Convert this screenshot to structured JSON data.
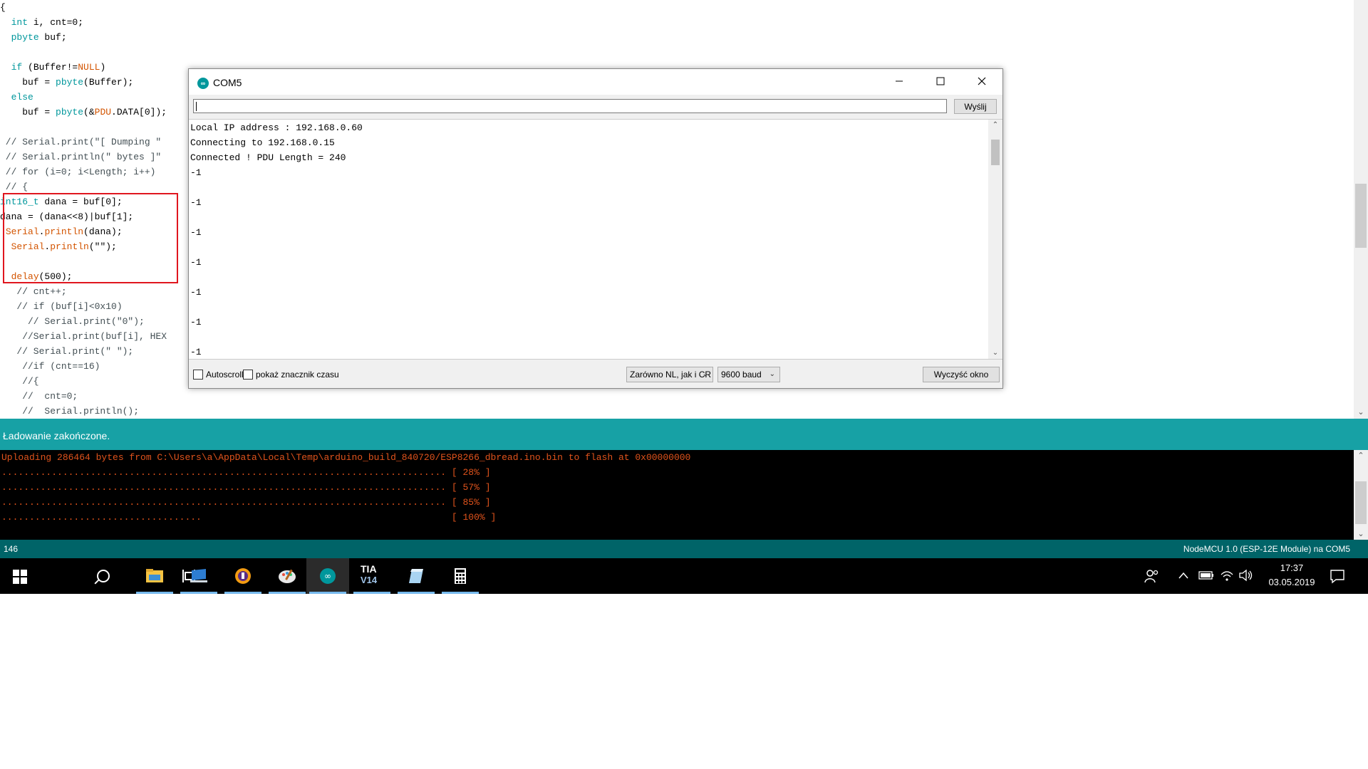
{
  "editor": {
    "lines": [
      [
        {
          "t": "{",
          "c": ""
        }
      ],
      [
        {
          "t": "  ",
          "c": ""
        },
        {
          "t": "int",
          "c": "kw"
        },
        {
          "t": " i, cnt=0;",
          "c": ""
        }
      ],
      [
        {
          "t": "  ",
          "c": ""
        },
        {
          "t": "pbyte",
          "c": "kw"
        },
        {
          "t": " buf;",
          "c": ""
        }
      ],
      [
        {
          "t": "",
          "c": ""
        }
      ],
      [
        {
          "t": "  ",
          "c": ""
        },
        {
          "t": "if",
          "c": "kw"
        },
        {
          "t": " (Buffer!=",
          "c": ""
        },
        {
          "t": "NULL",
          "c": "kw2"
        },
        {
          "t": ")",
          "c": ""
        }
      ],
      [
        {
          "t": "    buf = ",
          "c": ""
        },
        {
          "t": "pbyte",
          "c": "kw"
        },
        {
          "t": "(Buffer);",
          "c": ""
        }
      ],
      [
        {
          "t": "  ",
          "c": ""
        },
        {
          "t": "else",
          "c": "kw"
        }
      ],
      [
        {
          "t": "    buf = ",
          "c": ""
        },
        {
          "t": "pbyte",
          "c": "kw"
        },
        {
          "t": "(&",
          "c": ""
        },
        {
          "t": "PDU",
          "c": "kw2"
        },
        {
          "t": ".DATA[0]);",
          "c": ""
        }
      ],
      [
        {
          "t": "",
          "c": ""
        }
      ],
      [
        {
          "t": " // Serial.print(\"[ Dumping \"",
          "c": "cm"
        }
      ],
      [
        {
          "t": " // Serial.println(\" bytes ]\"",
          "c": "cm"
        }
      ],
      [
        {
          "t": " // for (i=0; i<Length; i++)",
          "c": "cm"
        }
      ],
      [
        {
          "t": " // {",
          "c": "cm"
        }
      ],
      [
        {
          "t": "int16_t",
          "c": "kw"
        },
        {
          "t": " dana = buf[0];",
          "c": ""
        }
      ],
      [
        {
          "t": "dana = (dana<<8)|buf[1];",
          "c": ""
        }
      ],
      [
        {
          "t": " ",
          "c": ""
        },
        {
          "t": "Serial",
          "c": "kw2"
        },
        {
          "t": ".",
          "c": ""
        },
        {
          "t": "println",
          "c": "kw2"
        },
        {
          "t": "(dana);",
          "c": ""
        }
      ],
      [
        {
          "t": "  ",
          "c": ""
        },
        {
          "t": "Serial",
          "c": "kw2"
        },
        {
          "t": ".",
          "c": ""
        },
        {
          "t": "println",
          "c": "kw2"
        },
        {
          "t": "(\"\");",
          "c": ""
        }
      ],
      [
        {
          "t": "",
          "c": ""
        }
      ],
      [
        {
          "t": "  ",
          "c": ""
        },
        {
          "t": "delay",
          "c": "kw2"
        },
        {
          "t": "(500);",
          "c": ""
        }
      ],
      [
        {
          "t": "   // cnt++;",
          "c": "cm"
        }
      ],
      [
        {
          "t": "   // if (buf[i]<0x10)",
          "c": "cm"
        }
      ],
      [
        {
          "t": "     // Serial.print(\"0\");",
          "c": "cm"
        }
      ],
      [
        {
          "t": "    //Serial.print(buf[i], HEX",
          "c": "cm"
        }
      ],
      [
        {
          "t": "   // Serial.print(\" \");",
          "c": "cm"
        }
      ],
      [
        {
          "t": "    //if (cnt==16)",
          "c": "cm"
        }
      ],
      [
        {
          "t": "    //{",
          "c": "cm"
        }
      ],
      [
        {
          "t": "    //  cnt=0;",
          "c": "cm"
        }
      ],
      [
        {
          "t": "    //  Serial.println();",
          "c": "cm"
        }
      ]
    ]
  },
  "status": {
    "message": "Ładowanie zakończone."
  },
  "console": {
    "lines": [
      "Uploading 286464 bytes from C:\\Users\\a\\AppData\\Local\\Temp\\arduino_build_840720/ESP8266_dbread.ino.bin to flash at 0x00000000",
      "................................................................................ [ 28% ]",
      "................................................................................ [ 57% ]",
      "................................................................................ [ 85% ]",
      "....................................                                             [ 100% ]"
    ]
  },
  "board_bar": {
    "line_number": "146",
    "board": "NodeMCU 1.0 (ESP-12E Module) na COM5"
  },
  "serial_monitor": {
    "title": "COM5",
    "logo_text": "∞",
    "input_value": "",
    "send_label": "Wyślij",
    "output_lines": [
      "Local IP address : 192.168.0.60",
      "Connecting to 192.168.0.15",
      "Connected ! PDU Length = 240",
      "-1",
      "",
      "-1",
      "",
      "-1",
      "",
      "-1",
      "",
      "-1",
      "",
      "-1",
      "",
      "-1"
    ],
    "autoscroll_label": "Autoscroll",
    "autoscroll_checked": false,
    "timestamp_label": "pokaż znacznik czasu",
    "timestamp_checked": false,
    "line_ending": "Zarówno NL, jak i CR",
    "baud": "9600 baud",
    "clear_label": "Wyczyść okno"
  },
  "taskbar": {
    "apps": [
      {
        "name": "file-explorer-icon",
        "running": true,
        "active": false
      },
      {
        "name": "remote-desktop-icon",
        "running": true,
        "active": false
      },
      {
        "name": "vpn-shield-icon",
        "running": true,
        "active": false
      },
      {
        "name": "paint-palette-icon",
        "running": true,
        "active": false
      },
      {
        "name": "arduino-icon",
        "running": true,
        "active": true
      },
      {
        "name": "tia-portal-icon",
        "running": true,
        "active": false
      },
      {
        "name": "notes-app-icon",
        "running": true,
        "active": false
      },
      {
        "name": "calculator-icon",
        "running": true,
        "active": false
      }
    ],
    "tia_text_top": "TIA",
    "tia_text_bottom": "V14",
    "clock_time": "17:37",
    "clock_date": "03.05.2019"
  },
  "colors": {
    "accent_teal": "#17a1a5",
    "board_bar": "#006468",
    "console_text": "#e0531c",
    "highlight_box": "#e0161f"
  }
}
